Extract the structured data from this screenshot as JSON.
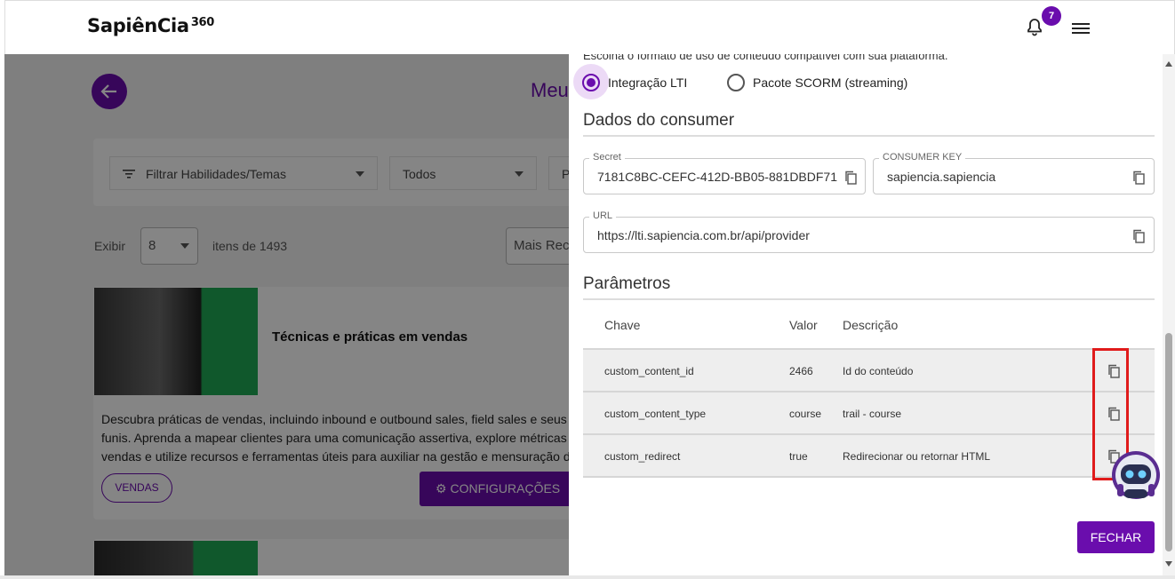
{
  "header": {
    "logo_text": "SapiênCia",
    "logo_suffix": "360",
    "notification_count": "7",
    "accent_color": "#6a0dad"
  },
  "background_page": {
    "title": "Meu",
    "filters": {
      "skills": "Filtrar Habilidades/Temas",
      "status": "Todos",
      "third": "P"
    },
    "show_label": "Exibir",
    "show_value": "8",
    "items_label": "itens de 1493",
    "sort_value": "Mais Rec",
    "card": {
      "title": "Técnicas e práticas em vendas",
      "description_lines": [
        "Descubra práticas de vendas, incluindo inbound e outbound sales, field sales e seus",
        "funis. Aprenda a mapear clientes para uma comunicação assertiva, explore métricas d",
        "vendas e utilize recursos e ferramentas úteis para auxiliar na gestão e mensuração da"
      ],
      "tag": "VENDAS",
      "config_button": "CONFIGURAÇÕES"
    }
  },
  "panel": {
    "intro": "Escolha o formato de uso de conteúdo compatível com sua plataforma.",
    "options": {
      "lti": "Integração LTI",
      "scorm": "Pacote SCORM (streaming)"
    },
    "selected_option": "lti",
    "consumer": {
      "section_title": "Dados do consumer",
      "secret_label": "Secret",
      "secret_value": "7181C8BC-CEFC-412D-BB05-881DBDF71",
      "key_label": "CONSUMER KEY",
      "key_value": "sapiencia.sapiencia",
      "url_label": "URL",
      "url_value": "https://lti.sapiencia.com.br/api/provider"
    },
    "params": {
      "section_title": "Parâmetros",
      "columns": {
        "key": "Chave",
        "value": "Valor",
        "description": "Descrição"
      },
      "rows": [
        {
          "key": "custom_content_id",
          "value": "2466",
          "description": "Id do conteúdo"
        },
        {
          "key": "custom_content_type",
          "value": "course",
          "description": "trail - course"
        },
        {
          "key": "custom_redirect",
          "value": "true",
          "description": "Redirecionar ou retornar HTML"
        }
      ]
    },
    "close_button": "FECHAR"
  }
}
